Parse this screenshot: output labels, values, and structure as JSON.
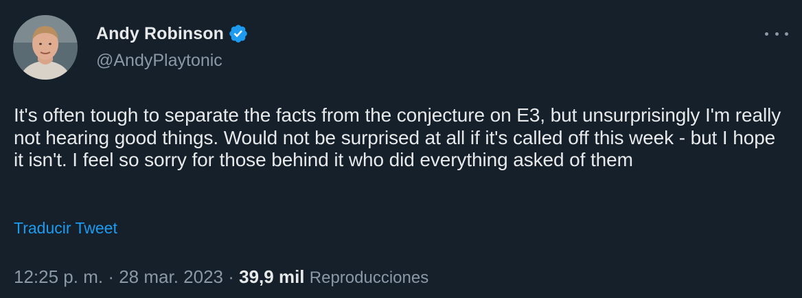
{
  "author": {
    "display_name": "Andy Robinson",
    "handle": "@AndyPlaytonic",
    "verified": true,
    "verified_color": "#1d9bf0"
  },
  "tweet": {
    "text": "It's often tough to separate the facts from the conjecture on E3, but unsurprisingly I'm really not hearing good things. Would not be surprised at all if it's called off this week - but I hope it isn't. I feel so sorry for those behind it who did everything asked of them",
    "translate_label": "Traducir Tweet",
    "time": "12:25 p. m.",
    "separator": "·",
    "date": "28 mar. 2023",
    "views_count": "39,9 mil",
    "views_label": "Reproducciones"
  },
  "icons": {
    "more": "more-horizontal-icon",
    "verified": "verified-badge-icon"
  },
  "theme": {
    "background": "#15202b",
    "text_primary": "#e7e9ea",
    "text_secondary": "#8b98a5",
    "accent": "#1d9bf0"
  }
}
